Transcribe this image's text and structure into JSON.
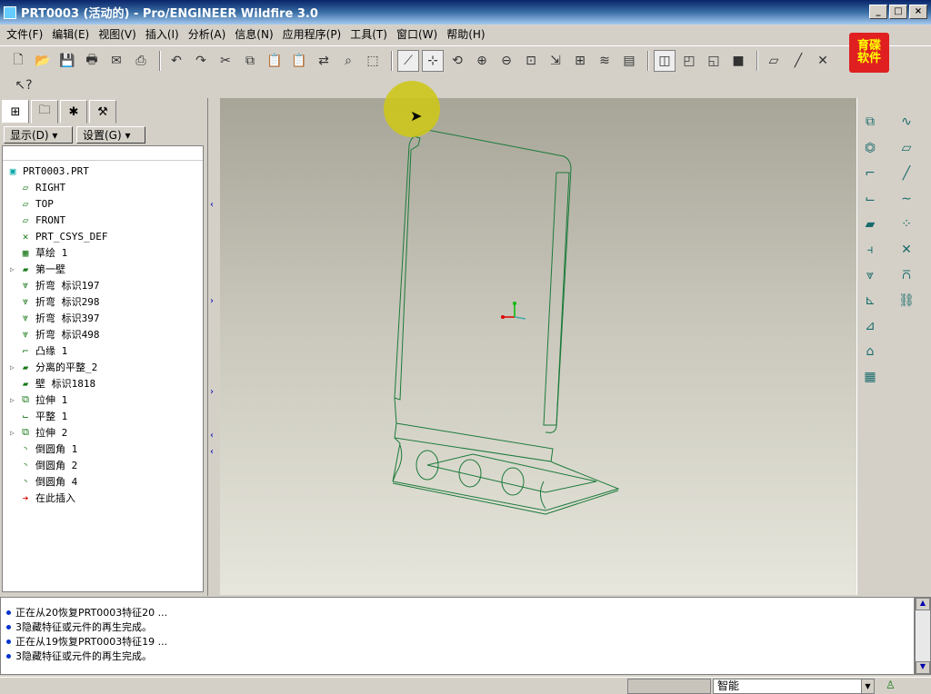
{
  "window": {
    "title": "PRT0003 (活动的) - Pro/ENGINEER Wildfire 3.0",
    "min": "_",
    "max": "□",
    "close": "×"
  },
  "menu": [
    "文件(F)",
    "编辑(E)",
    "视图(V)",
    "插入(I)",
    "分析(A)",
    "信息(N)",
    "应用程序(P)",
    "工具(T)",
    "窗口(W)",
    "帮助(H)"
  ],
  "logo": {
    "line1": "育碟",
    "line2": "软件"
  },
  "navigator": {
    "display_label": "显示(D) ▾",
    "settings_label": "设置(G) ▾",
    "root": "PRT0003.PRT",
    "items": [
      {
        "label": "RIGHT",
        "icon": "datum-plane-icon",
        "expand": false
      },
      {
        "label": "TOP",
        "icon": "datum-plane-icon",
        "expand": false
      },
      {
        "label": "FRONT",
        "icon": "datum-plane-icon",
        "expand": false
      },
      {
        "label": "PRT_CSYS_DEF",
        "icon": "csys-icon",
        "expand": false
      },
      {
        "label": "草绘 1",
        "icon": "sketch-icon",
        "expand": false
      },
      {
        "label": "第一壁",
        "icon": "wall-icon",
        "expand": true
      },
      {
        "label": "折弯 标识197",
        "icon": "bend-icon",
        "expand": false
      },
      {
        "label": "折弯 标识298",
        "icon": "bend-icon",
        "expand": false
      },
      {
        "label": "折弯 标识397",
        "icon": "bend-icon",
        "expand": false
      },
      {
        "label": "折弯 标识498",
        "icon": "bend-icon",
        "expand": false
      },
      {
        "label": "凸缘 1",
        "icon": "flange-icon",
        "expand": false
      },
      {
        "label": "分离的平整_2",
        "icon": "wall-icon",
        "expand": true
      },
      {
        "label": "壁 标识1818",
        "icon": "wall-icon",
        "expand": false
      },
      {
        "label": "拉伸 1",
        "icon": "extrude-icon",
        "expand": true
      },
      {
        "label": "平整 1",
        "icon": "flat-icon",
        "expand": false
      },
      {
        "label": "拉伸 2",
        "icon": "extrude-icon",
        "expand": true
      },
      {
        "label": "倒圆角 1",
        "icon": "round-icon",
        "expand": false
      },
      {
        "label": "倒圆角 2",
        "icon": "round-icon",
        "expand": false
      },
      {
        "label": "倒圆角 4",
        "icon": "round-icon",
        "expand": false
      },
      {
        "label": "在此插入",
        "icon": "insert-here-icon",
        "expand": false
      }
    ]
  },
  "messages": [
    "正在从20恢复PRT0003特征20 ...",
    "3隐藏特征或元件的再生完成。",
    "正在从19恢复PRT0003特征19 ...",
    "3隐藏特征或元件的再生完成。"
  ],
  "status": {
    "filter": "智能"
  },
  "colors": {
    "model_edge": "#1b7a3a",
    "title_bar": "#0a246a"
  }
}
